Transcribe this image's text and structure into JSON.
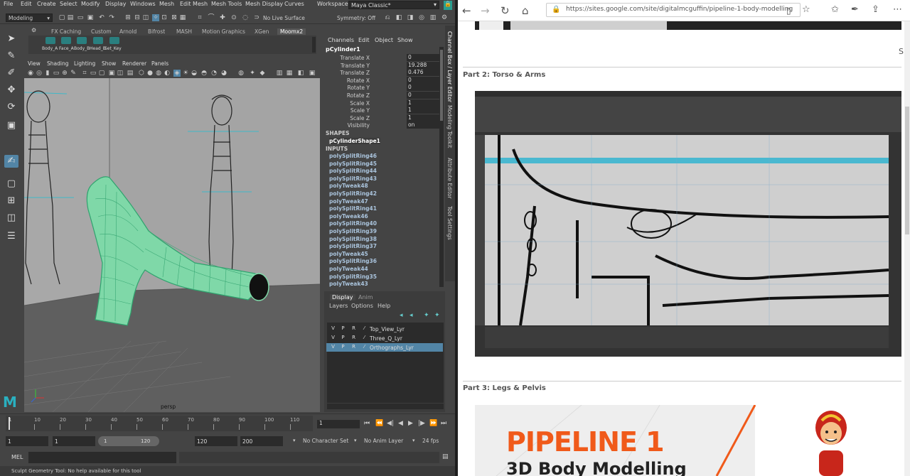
{
  "maya": {
    "menu": [
      "File",
      "Edit",
      "Create",
      "Select",
      "Modify",
      "Display",
      "Windows",
      "Mesh",
      "Edit Mesh",
      "Mesh Tools",
      "Mesh Display",
      "Curves"
    ],
    "workspace_label": "Workspace :",
    "workspace_value": "Maya Classic*",
    "mode_dropdown": "Modeling",
    "live_surface": "No Live Surface",
    "symmetry": "Symmetry: Off",
    "shelf_tabs": [
      "FX Caching",
      "Custom",
      "Arnold",
      "Bifrost",
      "MASH",
      "Motion Graphics",
      "XGen",
      "Moomx2"
    ],
    "shelf_buttons": [
      "Body_A",
      "Face_A",
      "Body_B",
      "Head_B",
      "Set_Key"
    ],
    "viewport_menu": [
      "View",
      "Shading",
      "Lighting",
      "Show",
      "Renderer",
      "Panels"
    ],
    "camera_label": "persp",
    "channel_menu": [
      "Channels",
      "Edit",
      "Object",
      "Show"
    ],
    "object_name": "pCylinder1",
    "attributes": [
      {
        "label": "Translate X",
        "value": "0"
      },
      {
        "label": "Translate Y",
        "value": "19.288"
      },
      {
        "label": "Translate Z",
        "value": "0.476"
      },
      {
        "label": "Rotate X",
        "value": "0"
      },
      {
        "label": "Rotate Y",
        "value": "0"
      },
      {
        "label": "Rotate Z",
        "value": "0"
      },
      {
        "label": "Scale X",
        "value": "1"
      },
      {
        "label": "Scale Y",
        "value": "1"
      },
      {
        "label": "Scale Z",
        "value": "1"
      },
      {
        "label": "Visibility",
        "value": "on"
      }
    ],
    "shapes_header": "SHAPES",
    "shape_name": "pCylinderShape1",
    "inputs_header": "INPUTS",
    "inputs": [
      "polySplitRing46",
      "polySplitRing45",
      "polySplitRing44",
      "polySplitRing43",
      "polyTweak48",
      "polySplitRing42",
      "polyTweak47",
      "polySplitRing41",
      "polyTweak46",
      "polySplitRing40",
      "polySplitRing39",
      "polySplitRing38",
      "polySplitRing37",
      "polyTweak45",
      "polySplitRing36",
      "polyTweak44",
      "polySplitRing35",
      "polyTweak43"
    ],
    "side_tabs": [
      "Channel Box / Layer Editor",
      "Modeling Toolkit",
      "Attribute Editor",
      "Tool Settings"
    ],
    "layer_tabs": [
      "Display",
      "Anim"
    ],
    "layer_menu": [
      "Layers",
      "Options",
      "Help"
    ],
    "layers": [
      {
        "v": "V",
        "p": "P",
        "r": "R",
        "name": "Top_View_Lyr",
        "selected": false
      },
      {
        "v": "V",
        "p": "P",
        "r": "R",
        "name": "Three_Q_Lyr",
        "selected": false
      },
      {
        "v": "V",
        "p": "P",
        "r": "R",
        "name": "Orthographs_Lyr",
        "selected": true
      }
    ],
    "timeline_ticks": [
      "1",
      "10",
      "20",
      "30",
      "40",
      "50",
      "60",
      "70",
      "80",
      "90",
      "100",
      "110"
    ],
    "current_frame": "1",
    "range_start": "1",
    "range_start2": "1",
    "range_slider_start": "1",
    "range_slider_end": "120",
    "range_end": "120",
    "range_end2": "200",
    "character_set": "No Character Set",
    "anim_layer": "No Anim Layer",
    "fps": "24 fps",
    "mel_label": "MEL",
    "status_text": "Sculpt Geometry Tool: No help available for this tool"
  },
  "browser": {
    "url": "https://sites.google.com/site/digitalmcguffin/pipeline-1-body-modelling",
    "part2_title": "Part 2: Torso & Arms",
    "part3_title": "Part 3: Legs & Pelvis",
    "banner_line1": "PIPELINE 1",
    "banner_line2": "3D Body Modelling"
  },
  "colors": {
    "maya_bg": "#444444",
    "maya_select": "#5285a6",
    "mesh_green": "#7fd8a8",
    "banner_orange": "#f05a1a",
    "maya_accent": "#2a9d8f"
  }
}
